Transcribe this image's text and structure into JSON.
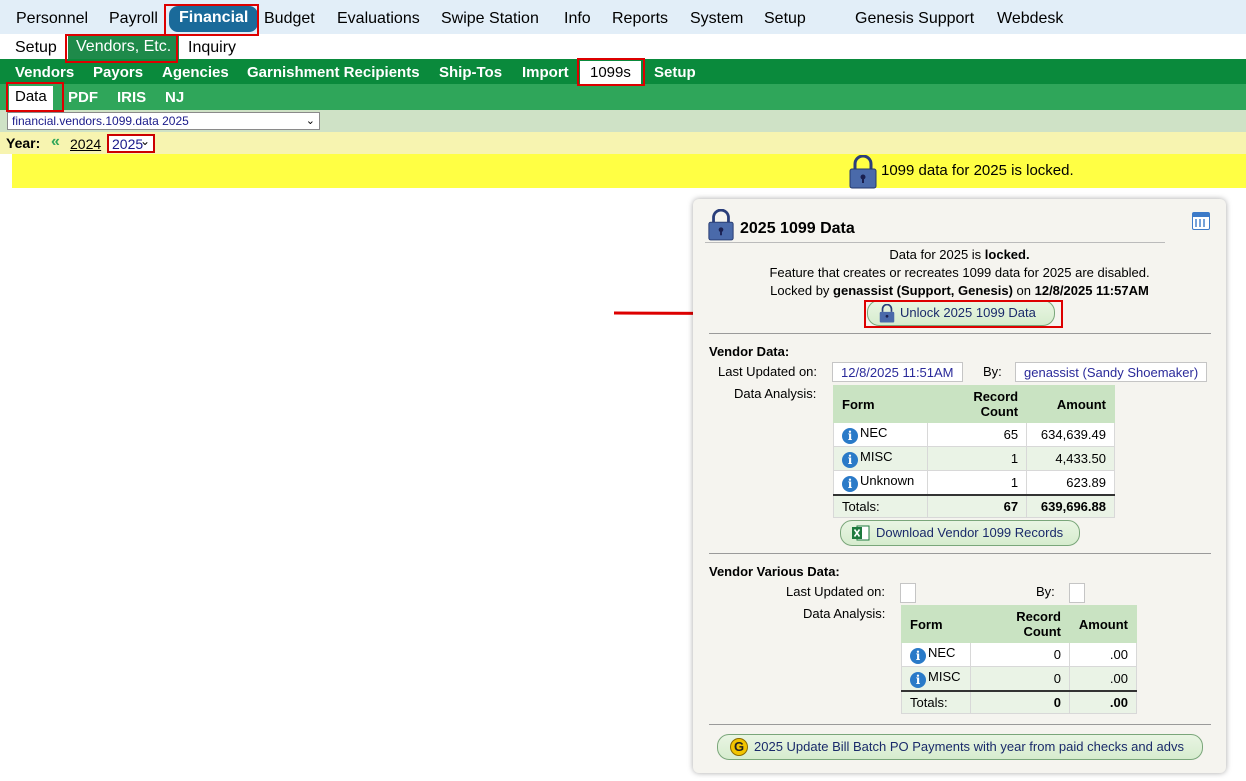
{
  "top_nav": [
    "Personnel",
    "Payroll",
    "Financial",
    "Budget",
    "Evaluations",
    "Swipe Station",
    "Info",
    "Reports",
    "System",
    "Setup",
    "Genesis Support",
    "Webdesk"
  ],
  "sub_nav": [
    "Setup",
    "Vendors, Etc.",
    "Inquiry"
  ],
  "green_nav": [
    "Vendors",
    "Payors",
    "Agencies",
    "Garnishment Recipients",
    "Ship-Tos",
    "Import",
    "1099s",
    "Setup"
  ],
  "light_green_nav": [
    "Data",
    "PDF",
    "IRIS",
    "NJ"
  ],
  "screen_select": "financial.vendors.1099.data 2025",
  "year_bar": {
    "label": "Year:",
    "prev_symbol": "«",
    "prev_year": "2024",
    "selected_year": "2025"
  },
  "banner_text": "1099 data for 2025 is locked.",
  "panel": {
    "title": "2025 1099 Data",
    "status_prefix": "Data for 2025 is ",
    "status_bold": "locked.",
    "feature_text": "Feature that creates or recreates 1099 data for 2025 are disabled.",
    "locked_by_prefix": "Locked by ",
    "locked_by_user": "genassist (Support, Genesis)",
    "locked_on_word": " on ",
    "locked_on_date": "12/8/2025 11:57AM",
    "unlock_button": "Unlock 2025 1099 Data",
    "vendor_data": {
      "heading": "Vendor Data:",
      "last_updated_label": "Last Updated on:",
      "last_updated_value": "12/8/2025 11:51AM",
      "by_label": "By:",
      "by_value": "genassist (Sandy Shoemaker)",
      "analysis_label": "Data Analysis:",
      "columns": [
        "Form",
        "Record Count",
        "Amount"
      ],
      "rows": [
        {
          "form": "NEC",
          "count": "65",
          "amount": "634,639.49"
        },
        {
          "form": "MISC",
          "count": "1",
          "amount": "4,433.50"
        },
        {
          "form": "Unknown",
          "count": "1",
          "amount": "623.89"
        }
      ],
      "totals": {
        "label": "Totals:",
        "count": "67",
        "amount": "639,696.88"
      },
      "download_button": "Download Vendor 1099 Records"
    },
    "vendor_various": {
      "heading": "Vendor Various Data:",
      "last_updated_label": "Last Updated on:",
      "by_label": "By:",
      "analysis_label": "Data Analysis:",
      "columns": [
        "Form",
        "Record Count",
        "Amount"
      ],
      "rows": [
        {
          "form": "NEC",
          "count": "0",
          "amount": ".00"
        },
        {
          "form": "MISC",
          "count": "0",
          "amount": ".00"
        }
      ],
      "totals": {
        "label": "Totals:",
        "count": "0",
        "amount": ".00"
      }
    },
    "bottom_button": "2025 Update Bill Batch PO Payments with year from paid checks and advs"
  },
  "colors": {
    "highlight": "#dd0000",
    "green": "#0a8a3c",
    "banner": "#ffff44",
    "blue_active": "#1a6a9a"
  }
}
